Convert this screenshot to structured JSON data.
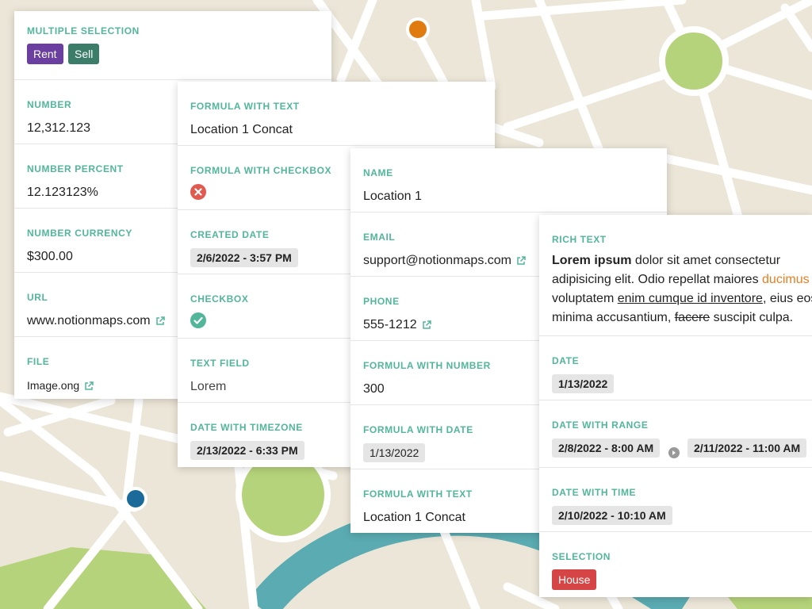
{
  "colors": {
    "map_bg": "#ece6d8",
    "road": "#ffffff",
    "park": "#b5d37a",
    "river": "#5aacb2",
    "accent_label": "#52b69a",
    "tag_rent": "#6b3fa0",
    "tag_sell": "#3c7d6a",
    "tag_house": "#d64545",
    "pin_orange": "#e07b0f",
    "pin_blue": "#1a6a9a"
  },
  "map": {
    "pins": [
      {
        "name": "orange-pin",
        "color": "#e07b0f"
      },
      {
        "name": "blue-pin",
        "color": "#1a6a9a"
      }
    ]
  },
  "card1": {
    "multiple_selection": {
      "label": "MULTIPLE SELECTION",
      "tags": [
        "Rent",
        "Sell"
      ]
    },
    "number": {
      "label": "NUMBER",
      "value": "12,312.123"
    },
    "number_percent": {
      "label": "NUMBER PERCENT",
      "value": "12.123123%"
    },
    "number_currency": {
      "label": "NUMBER CURRENCY",
      "value": "$300.00"
    },
    "url": {
      "label": "URL",
      "value": "www.notionmaps.com",
      "icon": "external-link-icon"
    },
    "file": {
      "label": "FILE",
      "value": "Image.ong",
      "icon": "external-link-icon"
    }
  },
  "card2": {
    "formula_text": {
      "label": "FORMULA WITH TEXT",
      "value": "Location 1 Concat"
    },
    "formula_checkbox": {
      "label": "FORMULA WITH CHECKBOX",
      "icon": "x-circle-icon"
    },
    "created_date": {
      "label": "CREATED DATE",
      "value": "2/6/2022 - 3:57 PM"
    },
    "checkbox": {
      "label": "CHECKBOX",
      "icon": "check-circle-icon"
    },
    "text_field": {
      "label": "TEXT FIELD",
      "value": "Lorem"
    },
    "date_timezone": {
      "label": "DATE WITH TIMEZONE",
      "value": "2/13/2022 - 6:33 PM"
    }
  },
  "card3": {
    "name": {
      "label": "NAME",
      "value": "Location 1"
    },
    "email": {
      "label": "EMAIL",
      "value": "support@notionmaps.com",
      "icon": "external-link-icon"
    },
    "phone": {
      "label": "PHONE",
      "value": "555-1212",
      "icon": "external-link-icon"
    },
    "formula_number": {
      "label": "FORMULA WITH NUMBER",
      "value": "300"
    },
    "formula_date": {
      "label": "FORMULA WITH DATE",
      "value": "1/13/2022"
    },
    "formula_text": {
      "label": "FORMULA WITH TEXT",
      "value": "Location 1 Concat"
    }
  },
  "card4": {
    "rich_text": {
      "label": "RICH TEXT",
      "bold": "Lorem ipsum",
      "part1": " dolor sit amet consectetur adipisicing elit. Odio repellat maiores ",
      "orange": "ducimus",
      "part2": " voluptatem ",
      "underline": "enim cumque id inventore",
      "part3": ", eius eos minima accusantium, ",
      "strike": "facere",
      "part4": " suscipit culpa."
    },
    "date": {
      "label": "DATE",
      "value": "1/13/2022"
    },
    "date_range": {
      "label": "DATE WITH RANGE",
      "start": "2/8/2022 - 8:00 AM",
      "end": "2/11/2022 - 11:00 AM",
      "icon": "arrow-right-circle-icon"
    },
    "date_time": {
      "label": "DATE WITH TIME",
      "value": "2/10/2022 - 10:10 AM"
    },
    "selection": {
      "label": "SELECTION",
      "value": "House"
    }
  }
}
